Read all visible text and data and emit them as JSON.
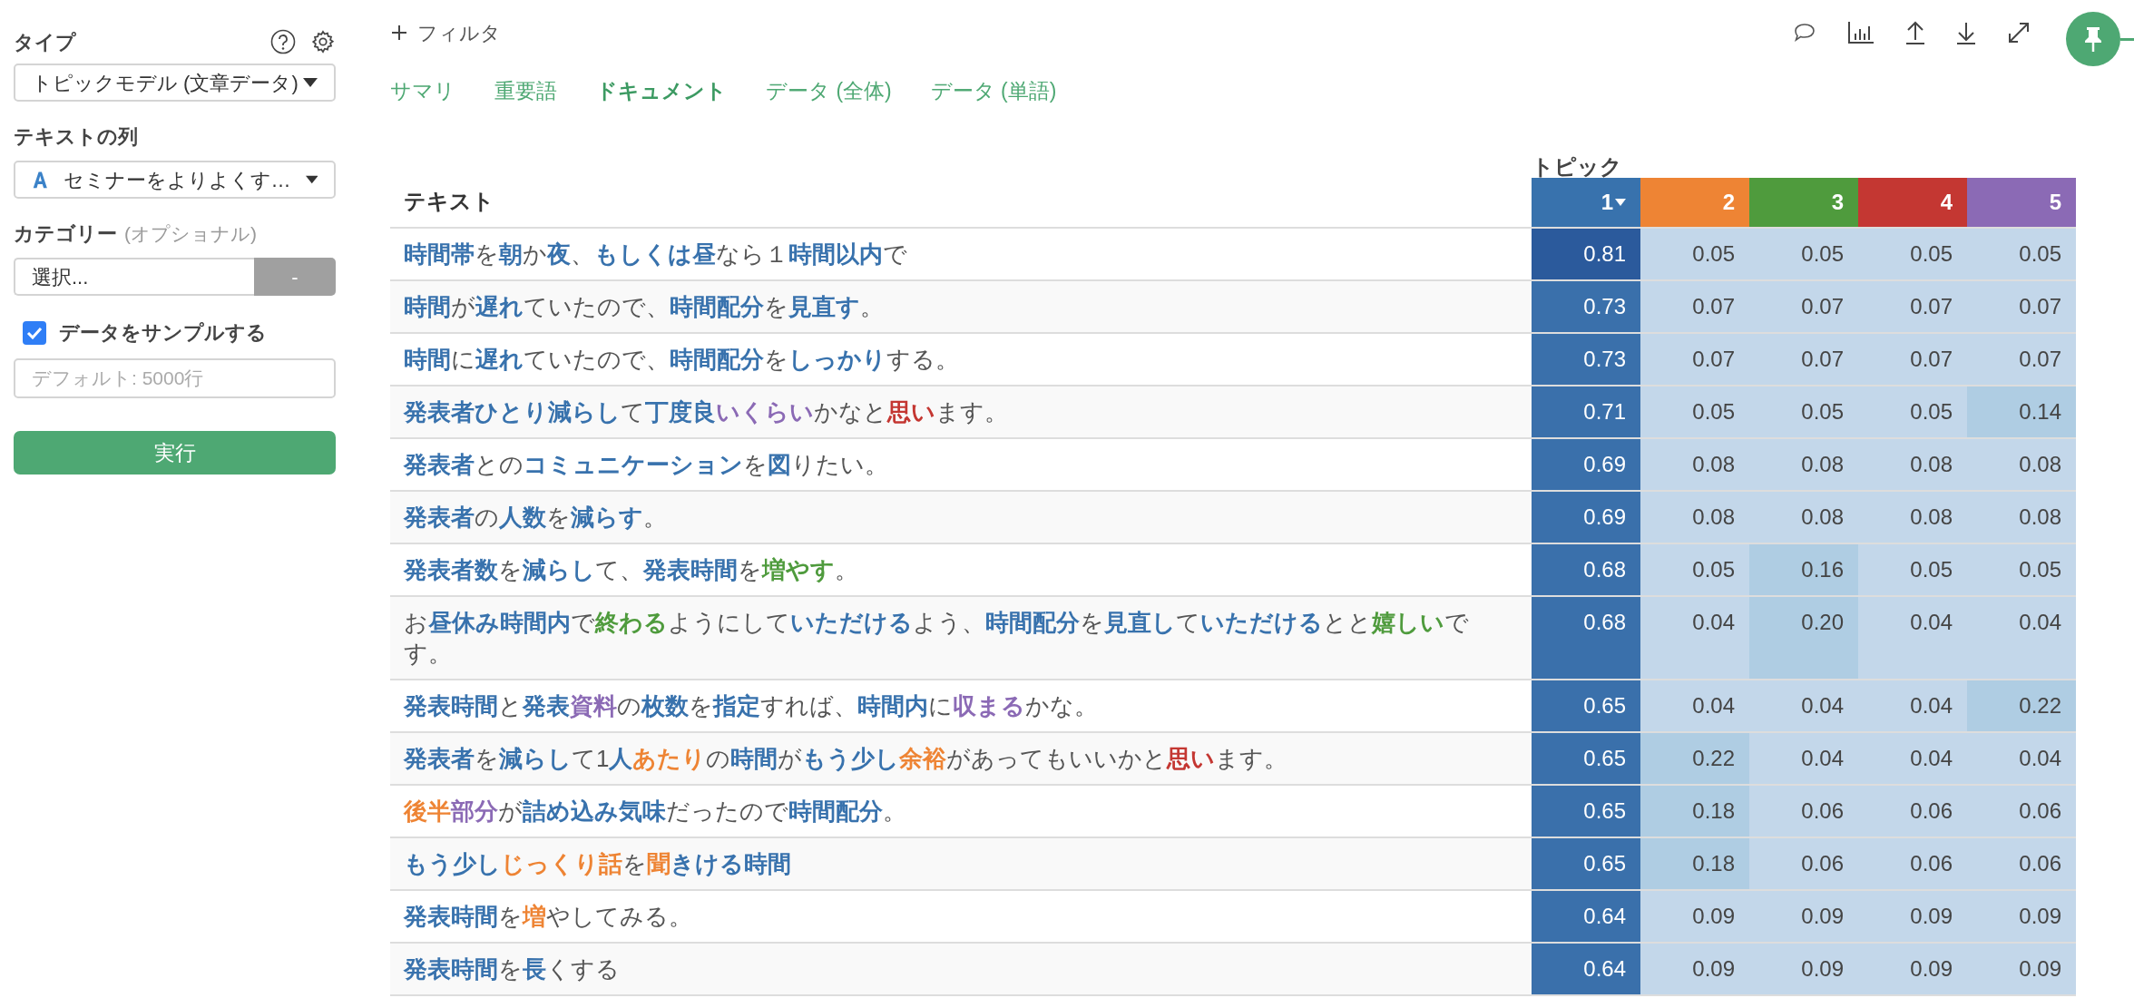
{
  "sidebar": {
    "type_label": "タイプ",
    "type_select": "トピックモデル (文章データ)",
    "text_column_label": "テキストの列",
    "text_column_select": "セミナーをよりよくす…",
    "category_label": "カテゴリー",
    "category_optional": "(オプショナル)",
    "category_select": "選択...",
    "category_button": "-",
    "sample": {
      "label": "データをサンプルする",
      "checked": true
    },
    "sample_input": {
      "placeholder": "デフォルト: 5000行"
    },
    "run_button": "実行"
  },
  "toolbar": {
    "filter": "フィルタ"
  },
  "tabs": [
    {
      "label": "サマリ",
      "selected": false
    },
    {
      "label": "重要語",
      "selected": false
    },
    {
      "label": "ドキュメント",
      "selected": true
    },
    {
      "label": "データ (全体)",
      "selected": false
    },
    {
      "label": "データ (単語)",
      "selected": false
    }
  ],
  "table": {
    "text_header": "テキスト",
    "topic_header": "トピック",
    "topics": [
      {
        "label": "1",
        "color": "#3872ad",
        "sorted": true
      },
      {
        "label": "2",
        "color": "#ee8434",
        "sorted": false
      },
      {
        "label": "3",
        "color": "#4f9b3d",
        "sorted": false
      },
      {
        "label": "4",
        "color": "#c43732",
        "sorted": false
      },
      {
        "label": "5",
        "color": "#8b6ab5",
        "sorted": false
      }
    ],
    "rows": [
      {
        "segments": [
          {
            "text": "時間帯",
            "color": "#3872ad"
          },
          {
            "text": "を"
          },
          {
            "text": "朝",
            "color": "#3872ad"
          },
          {
            "text": "か"
          },
          {
            "text": "夜",
            "color": "#3872ad"
          },
          {
            "text": "、"
          },
          {
            "text": "もしくは昼",
            "color": "#3872ad"
          },
          {
            "text": "なら１"
          },
          {
            "text": "時間以内",
            "color": "#3872ad"
          },
          {
            "text": "で"
          }
        ],
        "values": [
          "0.81",
          "0.05",
          "0.05",
          "0.05",
          "0.05"
        ]
      },
      {
        "segments": [
          {
            "text": "時間",
            "color": "#3872ad"
          },
          {
            "text": "が"
          },
          {
            "text": "遅れ",
            "color": "#3872ad"
          },
          {
            "text": "ていたので、"
          },
          {
            "text": "時間配分",
            "color": "#3872ad"
          },
          {
            "text": "を"
          },
          {
            "text": "見直す",
            "color": "#3872ad"
          },
          {
            "text": "。"
          }
        ],
        "values": [
          "0.73",
          "0.07",
          "0.07",
          "0.07",
          "0.07"
        ]
      },
      {
        "segments": [
          {
            "text": "時間",
            "color": "#3872ad"
          },
          {
            "text": "に"
          },
          {
            "text": "遅れ",
            "color": "#3872ad"
          },
          {
            "text": "ていたので、"
          },
          {
            "text": "時間配分",
            "color": "#3872ad"
          },
          {
            "text": "を"
          },
          {
            "text": "しっかり",
            "color": "#3872ad"
          },
          {
            "text": "する。"
          }
        ],
        "values": [
          "0.73",
          "0.07",
          "0.07",
          "0.07",
          "0.07"
        ]
      },
      {
        "segments": [
          {
            "text": "発表者ひとり減らし",
            "color": "#3872ad"
          },
          {
            "text": "て"
          },
          {
            "text": "丁度良",
            "color": "#3872ad"
          },
          {
            "text": "いくらい",
            "color": "#8b6ab5"
          },
          {
            "text": "かなと"
          },
          {
            "text": "思い",
            "color": "#c43732"
          },
          {
            "text": "ます。"
          }
        ],
        "values": [
          "0.71",
          "0.05",
          "0.05",
          "0.05",
          "0.14"
        ]
      },
      {
        "segments": [
          {
            "text": "発表者",
            "color": "#3872ad"
          },
          {
            "text": "との"
          },
          {
            "text": "コミュニケーション",
            "color": "#3872ad"
          },
          {
            "text": "を"
          },
          {
            "text": "図",
            "color": "#3872ad"
          },
          {
            "text": "りたい。"
          }
        ],
        "values": [
          "0.69",
          "0.08",
          "0.08",
          "0.08",
          "0.08"
        ]
      },
      {
        "segments": [
          {
            "text": "発表者",
            "color": "#3872ad"
          },
          {
            "text": "の"
          },
          {
            "text": "人数",
            "color": "#3872ad"
          },
          {
            "text": "を"
          },
          {
            "text": "減らす",
            "color": "#3872ad"
          },
          {
            "text": "。"
          }
        ],
        "values": [
          "0.69",
          "0.08",
          "0.08",
          "0.08",
          "0.08"
        ]
      },
      {
        "segments": [
          {
            "text": "発表者数",
            "color": "#3872ad"
          },
          {
            "text": "を"
          },
          {
            "text": "減らし",
            "color": "#3872ad"
          },
          {
            "text": "て、"
          },
          {
            "text": "発表時間",
            "color": "#3872ad"
          },
          {
            "text": "を"
          },
          {
            "text": "増やす",
            "color": "#4f9b3d"
          },
          {
            "text": "。"
          }
        ],
        "values": [
          "0.68",
          "0.05",
          "0.16",
          "0.05",
          "0.05"
        ]
      },
      {
        "segments": [
          {
            "text": "お"
          },
          {
            "text": "昼休み時間内",
            "color": "#3872ad"
          },
          {
            "text": "で"
          },
          {
            "text": "終わる",
            "color": "#4f9b3d"
          },
          {
            "text": "ようにして"
          },
          {
            "text": "いただける",
            "color": "#3872ad"
          },
          {
            "text": "よう、"
          },
          {
            "text": "時間配分",
            "color": "#3872ad"
          },
          {
            "text": "を"
          },
          {
            "text": "見直し",
            "color": "#3872ad"
          },
          {
            "text": "て"
          },
          {
            "text": "いただける",
            "color": "#3872ad"
          },
          {
            "text": "とと"
          },
          {
            "text": "嬉しい",
            "color": "#4f9b3d"
          },
          {
            "text": "です。"
          }
        ],
        "values": [
          "0.68",
          "0.04",
          "0.20",
          "0.04",
          "0.04"
        ]
      },
      {
        "segments": [
          {
            "text": "発表時間",
            "color": "#3872ad"
          },
          {
            "text": "と"
          },
          {
            "text": "発表",
            "color": "#3872ad"
          },
          {
            "text": "資料",
            "color": "#8b6ab5"
          },
          {
            "text": "の"
          },
          {
            "text": "枚数",
            "color": "#3872ad"
          },
          {
            "text": "を"
          },
          {
            "text": "指定",
            "color": "#3872ad"
          },
          {
            "text": "すれば、"
          },
          {
            "text": "時間内",
            "color": "#3872ad"
          },
          {
            "text": "に"
          },
          {
            "text": "収まる",
            "color": "#8b6ab5"
          },
          {
            "text": "かな。"
          }
        ],
        "values": [
          "0.65",
          "0.04",
          "0.04",
          "0.04",
          "0.22"
        ]
      },
      {
        "segments": [
          {
            "text": "発表者",
            "color": "#3872ad"
          },
          {
            "text": "を"
          },
          {
            "text": "減らし",
            "color": "#3872ad"
          },
          {
            "text": "て1"
          },
          {
            "text": "人",
            "color": "#3872ad"
          },
          {
            "text": "あたり",
            "color": "#ee8434"
          },
          {
            "text": "の"
          },
          {
            "text": "時間",
            "color": "#3872ad"
          },
          {
            "text": "が"
          },
          {
            "text": "もう少し",
            "color": "#3872ad"
          },
          {
            "text": "余裕",
            "color": "#ee8434"
          },
          {
            "text": "があってもいいかと"
          },
          {
            "text": "思い",
            "color": "#c43732"
          },
          {
            "text": "ます。"
          }
        ],
        "values": [
          "0.65",
          "0.22",
          "0.04",
          "0.04",
          "0.04"
        ]
      },
      {
        "segments": [
          {
            "text": "後半",
            "color": "#ee8434"
          },
          {
            "text": "部分",
            "color": "#8b6ab5"
          },
          {
            "text": "が"
          },
          {
            "text": "詰め込み気味",
            "color": "#3872ad"
          },
          {
            "text": "だったので"
          },
          {
            "text": "時間配分",
            "color": "#3872ad"
          },
          {
            "text": "。"
          }
        ],
        "values": [
          "0.65",
          "0.18",
          "0.06",
          "0.06",
          "0.06"
        ]
      },
      {
        "segments": [
          {
            "text": "もう少し",
            "color": "#3872ad"
          },
          {
            "text": "じっくり話",
            "color": "#ee8434"
          },
          {
            "text": "を"
          },
          {
            "text": "聞",
            "color": "#ee8434"
          },
          {
            "text": "きける時間",
            "color": "#3872ad"
          }
        ],
        "values": [
          "0.65",
          "0.18",
          "0.06",
          "0.06",
          "0.06"
        ]
      },
      {
        "segments": [
          {
            "text": "発表時間",
            "color": "#3872ad"
          },
          {
            "text": "を"
          },
          {
            "text": "増",
            "color": "#ee8434"
          },
          {
            "text": "やしてみる。"
          }
        ],
        "values": [
          "0.64",
          "0.09",
          "0.09",
          "0.09",
          "0.09"
        ]
      },
      {
        "segments": [
          {
            "text": "発表時間",
            "color": "#3872ad"
          },
          {
            "text": "を"
          },
          {
            "text": "長",
            "color": "#3872ad"
          },
          {
            "text": "くする"
          }
        ],
        "values": [
          "0.64",
          "0.09",
          "0.09",
          "0.09",
          "0.09"
        ]
      }
    ]
  }
}
